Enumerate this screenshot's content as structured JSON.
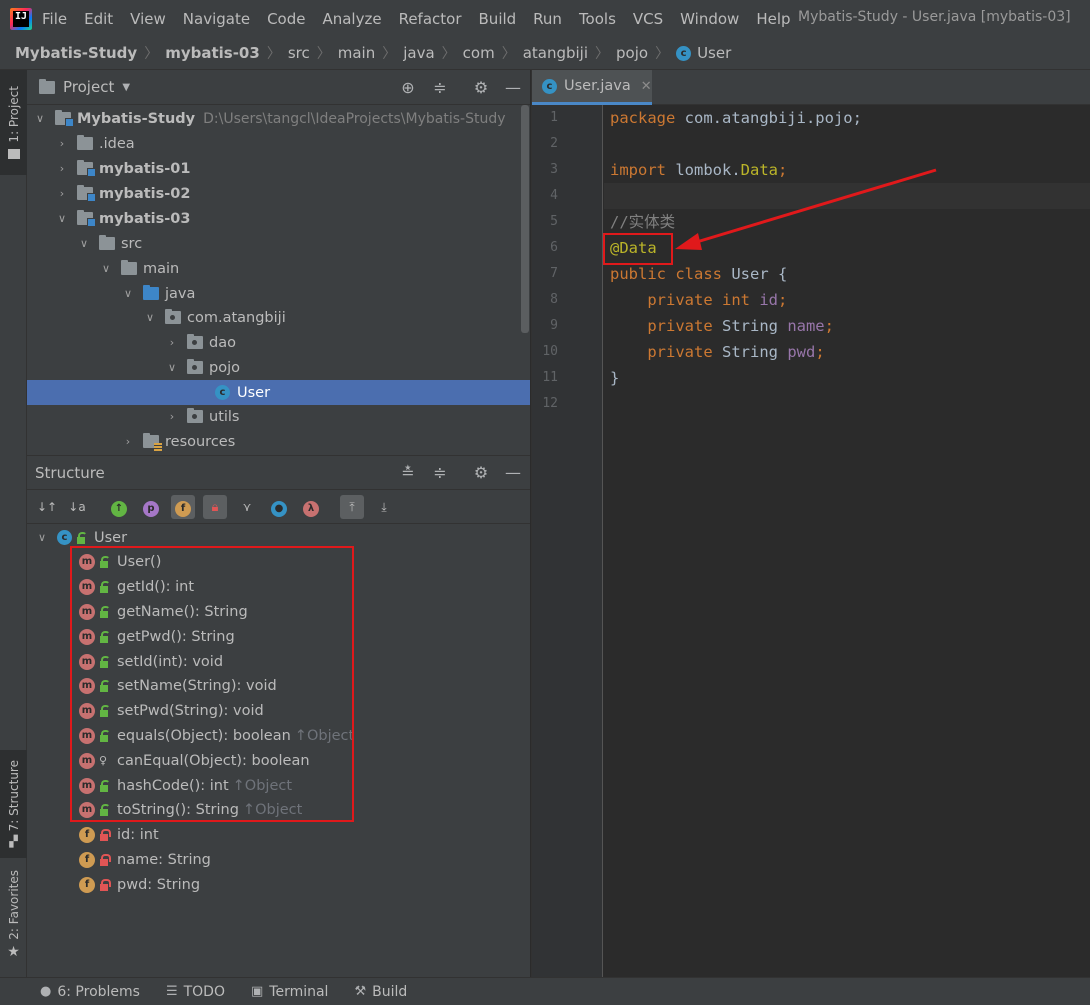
{
  "menu": [
    "File",
    "Edit",
    "View",
    "Navigate",
    "Code",
    "Analyze",
    "Refactor",
    "Build",
    "Run",
    "Tools",
    "VCS",
    "Window",
    "Help"
  ],
  "window_title": "Mybatis-Study - User.java [mybatis-03]",
  "app_logo": "IJ",
  "breadcrumb": [
    "Mybatis-Study",
    "mybatis-03",
    "src",
    "main",
    "java",
    "com",
    "atangbiji",
    "pojo",
    "User"
  ],
  "side_tabs": {
    "project": "1: Project",
    "structure": "7: Structure",
    "favorites": "2: Favorites"
  },
  "project_panel": {
    "title": "Project",
    "tree": [
      {
        "label": "Mybatis-Study",
        "path": "D:\\Users\\tangcl\\IdeaProjects\\Mybatis-Study",
        "icon": "module-folder-icon"
      },
      {
        "label": ".idea",
        "icon": "folder-icon"
      },
      {
        "label": "mybatis-01",
        "icon": "module-folder-icon"
      },
      {
        "label": "mybatis-02",
        "icon": "module-folder-icon"
      },
      {
        "label": "mybatis-03",
        "icon": "module-folder-icon"
      },
      {
        "label": "src",
        "icon": "folder-icon"
      },
      {
        "label": "main",
        "icon": "folder-icon"
      },
      {
        "label": "java",
        "icon": "source-folder-icon"
      },
      {
        "label": "com.atangbiji",
        "icon": "package-icon"
      },
      {
        "label": "dao",
        "icon": "package-icon"
      },
      {
        "label": "pojo",
        "icon": "package-icon"
      },
      {
        "label": "User",
        "icon": "class-icon"
      },
      {
        "label": "utils",
        "icon": "package-icon"
      },
      {
        "label": "resources",
        "icon": "resources-folder-icon"
      }
    ]
  },
  "structure_panel": {
    "title": "Structure",
    "root": "User",
    "members": [
      {
        "label": "User()",
        "kind": "method"
      },
      {
        "label": "getId(): int",
        "kind": "method"
      },
      {
        "label": "getName(): String",
        "kind": "method"
      },
      {
        "label": "getPwd(): String",
        "kind": "method"
      },
      {
        "label": "setId(int): void",
        "kind": "method"
      },
      {
        "label": "setName(String): void",
        "kind": "method"
      },
      {
        "label": "setPwd(String): void",
        "kind": "method"
      },
      {
        "label": "equals(Object): boolean",
        "inherit": "↑Object",
        "kind": "method"
      },
      {
        "label": "canEqual(Object): boolean",
        "kind": "method-protected"
      },
      {
        "label": "hashCode(): int",
        "inherit": "↑Object",
        "kind": "method"
      },
      {
        "label": "toString(): String",
        "inherit": "↑Object",
        "kind": "method"
      },
      {
        "label": "id: int",
        "kind": "field"
      },
      {
        "label": "name: String",
        "kind": "field"
      },
      {
        "label": "pwd: String",
        "kind": "field"
      }
    ]
  },
  "editor": {
    "tab_label": "User.java",
    "line_numbers": [
      "1",
      "2",
      "3",
      "4",
      "5",
      "6",
      "7",
      "8",
      "9",
      "10",
      "11",
      "12"
    ],
    "code": {
      "l1_kw": "package",
      "l1_rest": " com.atangbiji.pojo;",
      "l3_kw": "import",
      "l3_mid": " lombok.",
      "l3_ann": "Data",
      "l3_end": ";",
      "l5": "//实体类",
      "l6": "@Data",
      "l7_kw1": "public",
      "l7_kw2": " class",
      "l7_rest": " User {",
      "l8_kw1": "    private",
      "l8_kw2": " int",
      "l8_fld": " id",
      "l8_end": ";",
      "l9_kw1": "    private",
      "l9_type": " String",
      "l9_fld": " name",
      "l9_end": ";",
      "l10_kw1": "    private",
      "l10_type": " String",
      "l10_fld": " pwd",
      "l10_end": ";",
      "l11": "}"
    }
  },
  "status_bar": {
    "problems": "6: Problems",
    "todo": "TODO",
    "terminal": "Terminal",
    "build": "Build"
  },
  "colors": {
    "selection": "#4b6eaf",
    "highlight": "#e0191b",
    "keyword": "#cc7832",
    "annotation": "#bbb529"
  }
}
